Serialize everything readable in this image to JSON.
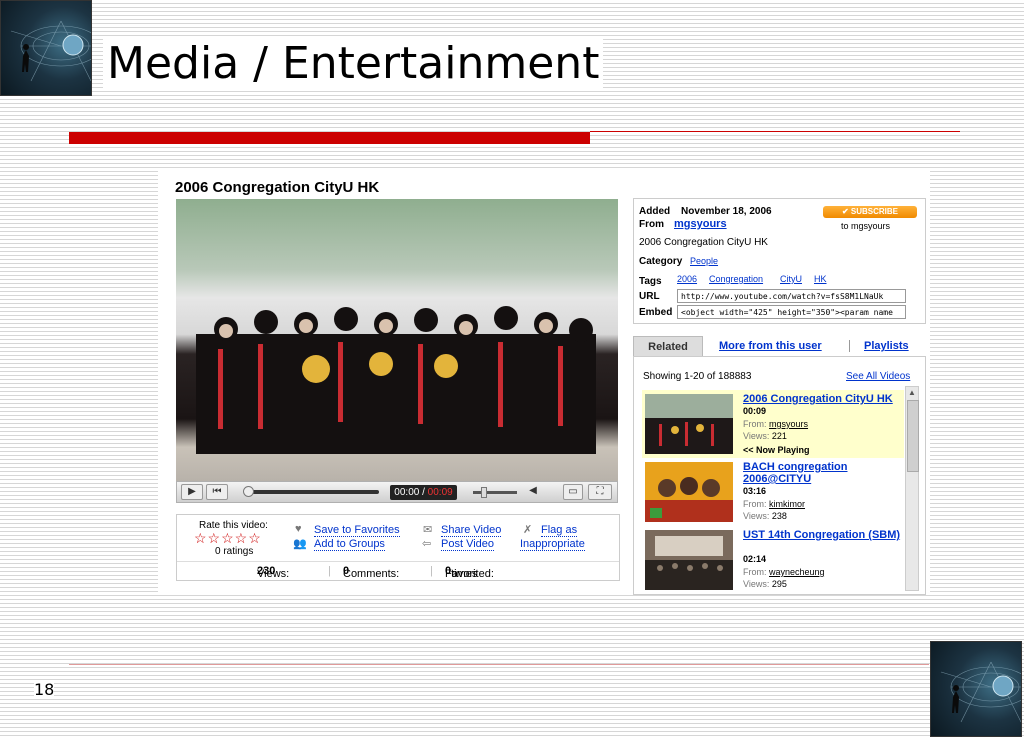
{
  "slide": {
    "title": "Media / Entertainment",
    "page_number": "18"
  },
  "colors": {
    "accent_red": "#cc0000",
    "link_blue": "#0033cc",
    "subscribe_orange": "#f08a00",
    "now_playing_bg": "#ffffcc"
  },
  "video": {
    "title": "2006 Congregation CityU HK",
    "time_current": "00:00",
    "time_separator": "/",
    "time_total": "00:09",
    "progress": 0.0
  },
  "actions": {
    "rate_label": "Rate this video:",
    "stars": "☆☆☆☆☆",
    "ratings": "0 ratings",
    "save_to_favorites": "Save to Favorites",
    "add_to_groups": "Add to Groups",
    "share_video": "Share Video",
    "post_video": "Post Video",
    "flag_as": "Flag as",
    "inappropriate": "Inappropriate"
  },
  "stats": {
    "views_label": "Views:",
    "views": "230",
    "comments_label": "Comments:",
    "comments": "0",
    "favorited_label": "Favorited:",
    "favorited": "0",
    "favorited_suffix": "times"
  },
  "info": {
    "added_label": "Added",
    "added_date": "November 18, 2006",
    "from_label": "From",
    "from_user": "mgsyours",
    "subscribe_label": "✔ SUBSCRIBE",
    "subscribe_to": "to mgsyours",
    "description": "2006 Congregation CityU HK",
    "category_label": "Category",
    "category": "People",
    "tags_label": "Tags",
    "tags": [
      "2006",
      "Congregation",
      "CityU",
      "HK"
    ],
    "url_label": "URL",
    "url_value": "http://www.youtube.com/watch?v=fsS8M1LNaUk",
    "embed_label": "Embed",
    "embed_value": "<object width=\"425\" height=\"350\"><param name"
  },
  "tabs": {
    "related": "Related",
    "more_from_user": "More from this user",
    "playlists": "Playlists"
  },
  "related": {
    "showing": "Showing 1-20 of 188883",
    "see_all": "See All Videos",
    "from_label": "From:",
    "views_label": "Views:",
    "now_playing": "<< Now Playing",
    "items": [
      {
        "title": "2006 Congregation CityU HK",
        "duration": "00:09",
        "from": "mgsyours",
        "views": "221"
      },
      {
        "title": "BACH congregation 2006@CITYU",
        "duration": "03:16",
        "from": "kimkimor",
        "views": "238"
      },
      {
        "title": "UST 14th Congregation (SBM)",
        "duration": "02:14",
        "from": "waynecheung",
        "views": "295"
      }
    ]
  }
}
